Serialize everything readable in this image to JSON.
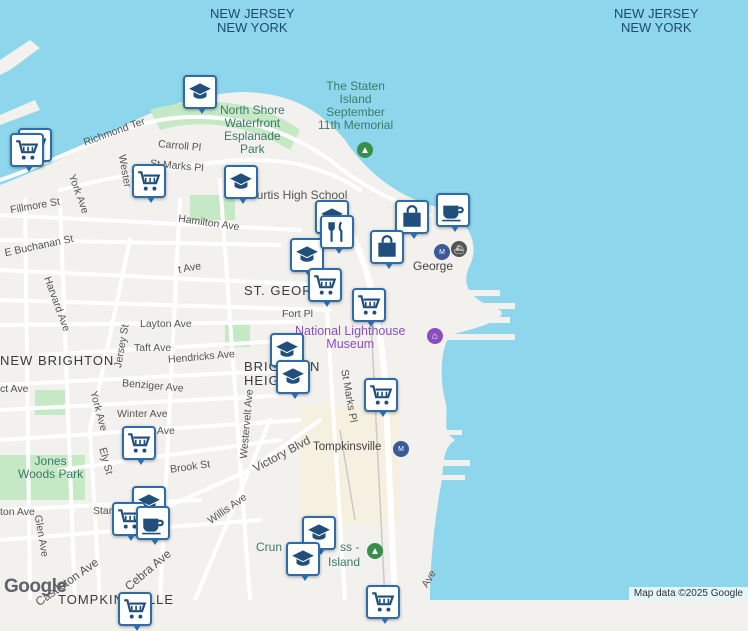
{
  "water_labels": [
    "NEW JERSEY",
    "NEW YORK"
  ],
  "neighborhoods": {
    "st_george": "ST. GEORGE",
    "new_brighton": "NEW BRIGHTON",
    "brighton_line1": "BRIGHTON",
    "brighton_line2": "HEIGHTS",
    "tompkinsville_area": "TOMPKINSVILLE"
  },
  "pois": {
    "memorial": [
      "The Staten",
      "Island",
      "September",
      "11th Memorial"
    ],
    "esplanade": [
      "North Shore",
      "Waterfront",
      "Esplanade",
      "Park"
    ],
    "school": "Curtis High School",
    "lighthouse": [
      "National Lighthouse",
      "Museum"
    ],
    "jones_woods": [
      "Jones",
      "Woods Park"
    ],
    "cruise_left": "Crun",
    "cruise_mid": "ss -",
    "cruise_bottom": "Island",
    "st_george_ferry": "George"
  },
  "stations": {
    "tompkinsville": "Tompkinsville"
  },
  "streets": {
    "richmond_ter": "Richmond Ter",
    "carroll_pl": "Carroll Pl",
    "st_marks_pl_top": "St Marks Pl",
    "hamilton_ave": "Hamilton Ave",
    "fillmore_st": "Fillmore St",
    "buchanan_st": "E Buchanan St",
    "harvard_ave": "Harvard Ave",
    "york_ave_top": "York Ave",
    "layton_ave": "Layton Ave",
    "taft_ave": "Taft Ave",
    "hendricks_ave": "Hendricks Ave",
    "benziger_ave": "Benziger Ave",
    "winter_ave": "Winter Ave",
    "jersey_st": "Jersey St",
    "york_ave": "York Ave",
    "westervelt_ave": "Westervelt Ave",
    "st_marks_pl": "St Marks Pl",
    "fort_pl": "Fort Pl",
    "brook_st": "Brook St",
    "victory_blvd": "Victory Blvd",
    "willis_ave": "Willis Ave",
    "ely_st": "Ely St",
    "glen_ave": "Glen Ave",
    "castleton_ave": "Castleton Ave",
    "cebra_ave": "Cebra Ave",
    "ave_right": "Ave",
    "elt_ave": "ct Ave",
    "ston_ave": "ton Ave",
    "ave_top": "t Ave",
    "westervelt_top": "Wester",
    "upper_ave": "ver Ave",
    "stan": "Stan"
  },
  "markers": [
    {
      "icon": "school"
    },
    {
      "icon": "shopping-cart"
    },
    {
      "icon": "shopping-cart"
    },
    {
      "icon": "shopping-cart"
    },
    {
      "icon": "school"
    },
    {
      "icon": "school"
    },
    {
      "icon": "school"
    },
    {
      "icon": "restaurant"
    },
    {
      "icon": "shopping-bag"
    },
    {
      "icon": "coffee"
    },
    {
      "icon": "shopping-bag"
    },
    {
      "icon": "shopping-cart"
    },
    {
      "icon": "shopping-cart"
    },
    {
      "icon": "school"
    },
    {
      "icon": "school"
    },
    {
      "icon": "shopping-cart"
    },
    {
      "icon": "shopping-cart"
    },
    {
      "icon": "school"
    },
    {
      "icon": "shopping-cart"
    },
    {
      "icon": "coffee"
    },
    {
      "icon": "school"
    },
    {
      "icon": "school"
    },
    {
      "icon": "shopping-cart"
    },
    {
      "icon": "shopping-cart"
    }
  ],
  "attribution": {
    "logo": "Google",
    "credit": "Map data ©2025 Google"
  },
  "colors": {
    "water": "#8ed6eb",
    "land": "#f2f1ee",
    "park": "#c5e8c5",
    "marker_border": "#2d6ca8",
    "marker_icon": "#1f4f7a"
  }
}
